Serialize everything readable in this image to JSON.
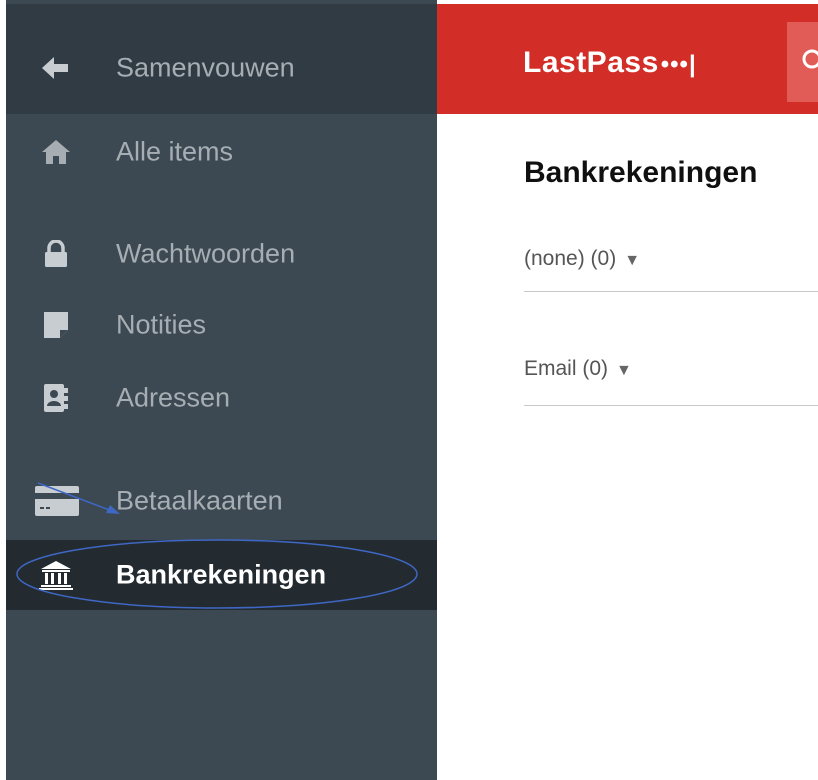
{
  "sidebar": {
    "collapse_label": "Samenvouwen",
    "items": [
      {
        "label": "Alle items",
        "icon": "home-icon"
      },
      {
        "label": "Wachtwoorden",
        "icon": "lock-icon"
      },
      {
        "label": "Notities",
        "icon": "note-icon"
      },
      {
        "label": "Adressen",
        "icon": "address-book-icon"
      },
      {
        "label": "Betaalkaarten",
        "icon": "credit-card-icon"
      },
      {
        "label": "Bankrekeningen",
        "icon": "bank-icon",
        "active": true
      }
    ]
  },
  "header": {
    "logo_text": "LastPass",
    "logo_dots": "•••|",
    "brand_color": "#d32d27"
  },
  "main": {
    "title": "Bankrekeningen",
    "groups": [
      {
        "label": "(none) (0)",
        "arrow": "▼"
      },
      {
        "label": "Email (0)",
        "arrow": "▼"
      }
    ]
  },
  "colors": {
    "sidebar_bg": "#3c4952",
    "sidebar_active_bg": "#232b31",
    "annotation": "#3f67c4"
  }
}
